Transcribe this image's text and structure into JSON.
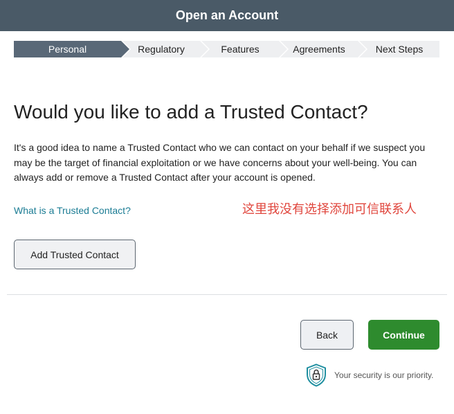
{
  "header": {
    "title": "Open an Account"
  },
  "steps": [
    {
      "label": "Personal",
      "active": true
    },
    {
      "label": "Regulatory",
      "active": false
    },
    {
      "label": "Features",
      "active": false
    },
    {
      "label": "Agreements",
      "active": false
    },
    {
      "label": "Next Steps",
      "active": false
    }
  ],
  "main": {
    "heading": "Would you like to add a Trusted Contact?",
    "description": "It's a good idea to name a Trusted Contact who we can contact on your behalf if we suspect you may be the target of financial exploitation or we have concerns about your well-being. You can always add or remove a Trusted Contact after your account is opened.",
    "help_link": "What is a Trusted Contact?",
    "annotation": "这里我没有选择添加可信联系人",
    "add_button": "Add Trusted Contact"
  },
  "footer": {
    "back_label": "Back",
    "continue_label": "Continue",
    "security_text": "Your security is our priority."
  },
  "colors": {
    "header_bg": "#4a5a67",
    "active_step": "#596877",
    "continue_green": "#2e8b2e",
    "link_teal": "#1b7c94",
    "annotation_red": "#e0463d",
    "shield_teal": "#1f8fa0"
  },
  "icons": {
    "security": "shield-lock-icon"
  }
}
